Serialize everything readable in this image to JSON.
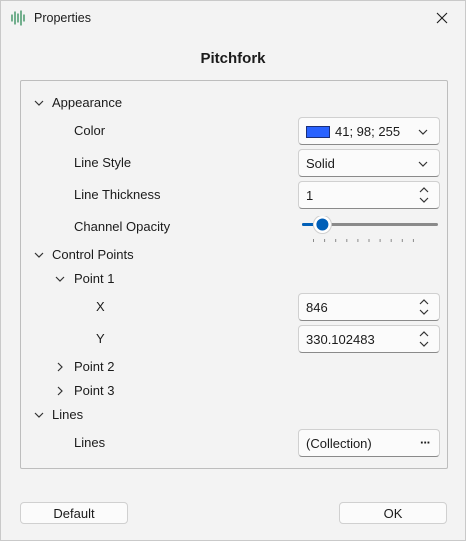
{
  "window": {
    "title": "Properties",
    "heading": "Pitchfork"
  },
  "appearance": {
    "group_label": "Appearance",
    "color_label": "Color",
    "color_value": "41; 98; 255",
    "color_hex": "#2962ff",
    "line_style_label": "Line Style",
    "line_style_value": "Solid",
    "line_thickness_label": "Line Thickness",
    "line_thickness_value": "1",
    "channel_opacity_label": "Channel Opacity",
    "channel_opacity_level": 0.15
  },
  "control_points": {
    "group_label": "Control Points",
    "point1_label": "Point 1",
    "x_label": "X",
    "x_value": "846",
    "y_label": "Y",
    "y_value": "330.102483",
    "point2_label": "Point 2",
    "point3_label": "Point 3"
  },
  "lines": {
    "group_label": "Lines",
    "lines_label": "Lines",
    "lines_value": "(Collection)",
    "ellipsis": "···"
  },
  "buttons": {
    "default_label": "Default",
    "ok_label": "OK"
  }
}
